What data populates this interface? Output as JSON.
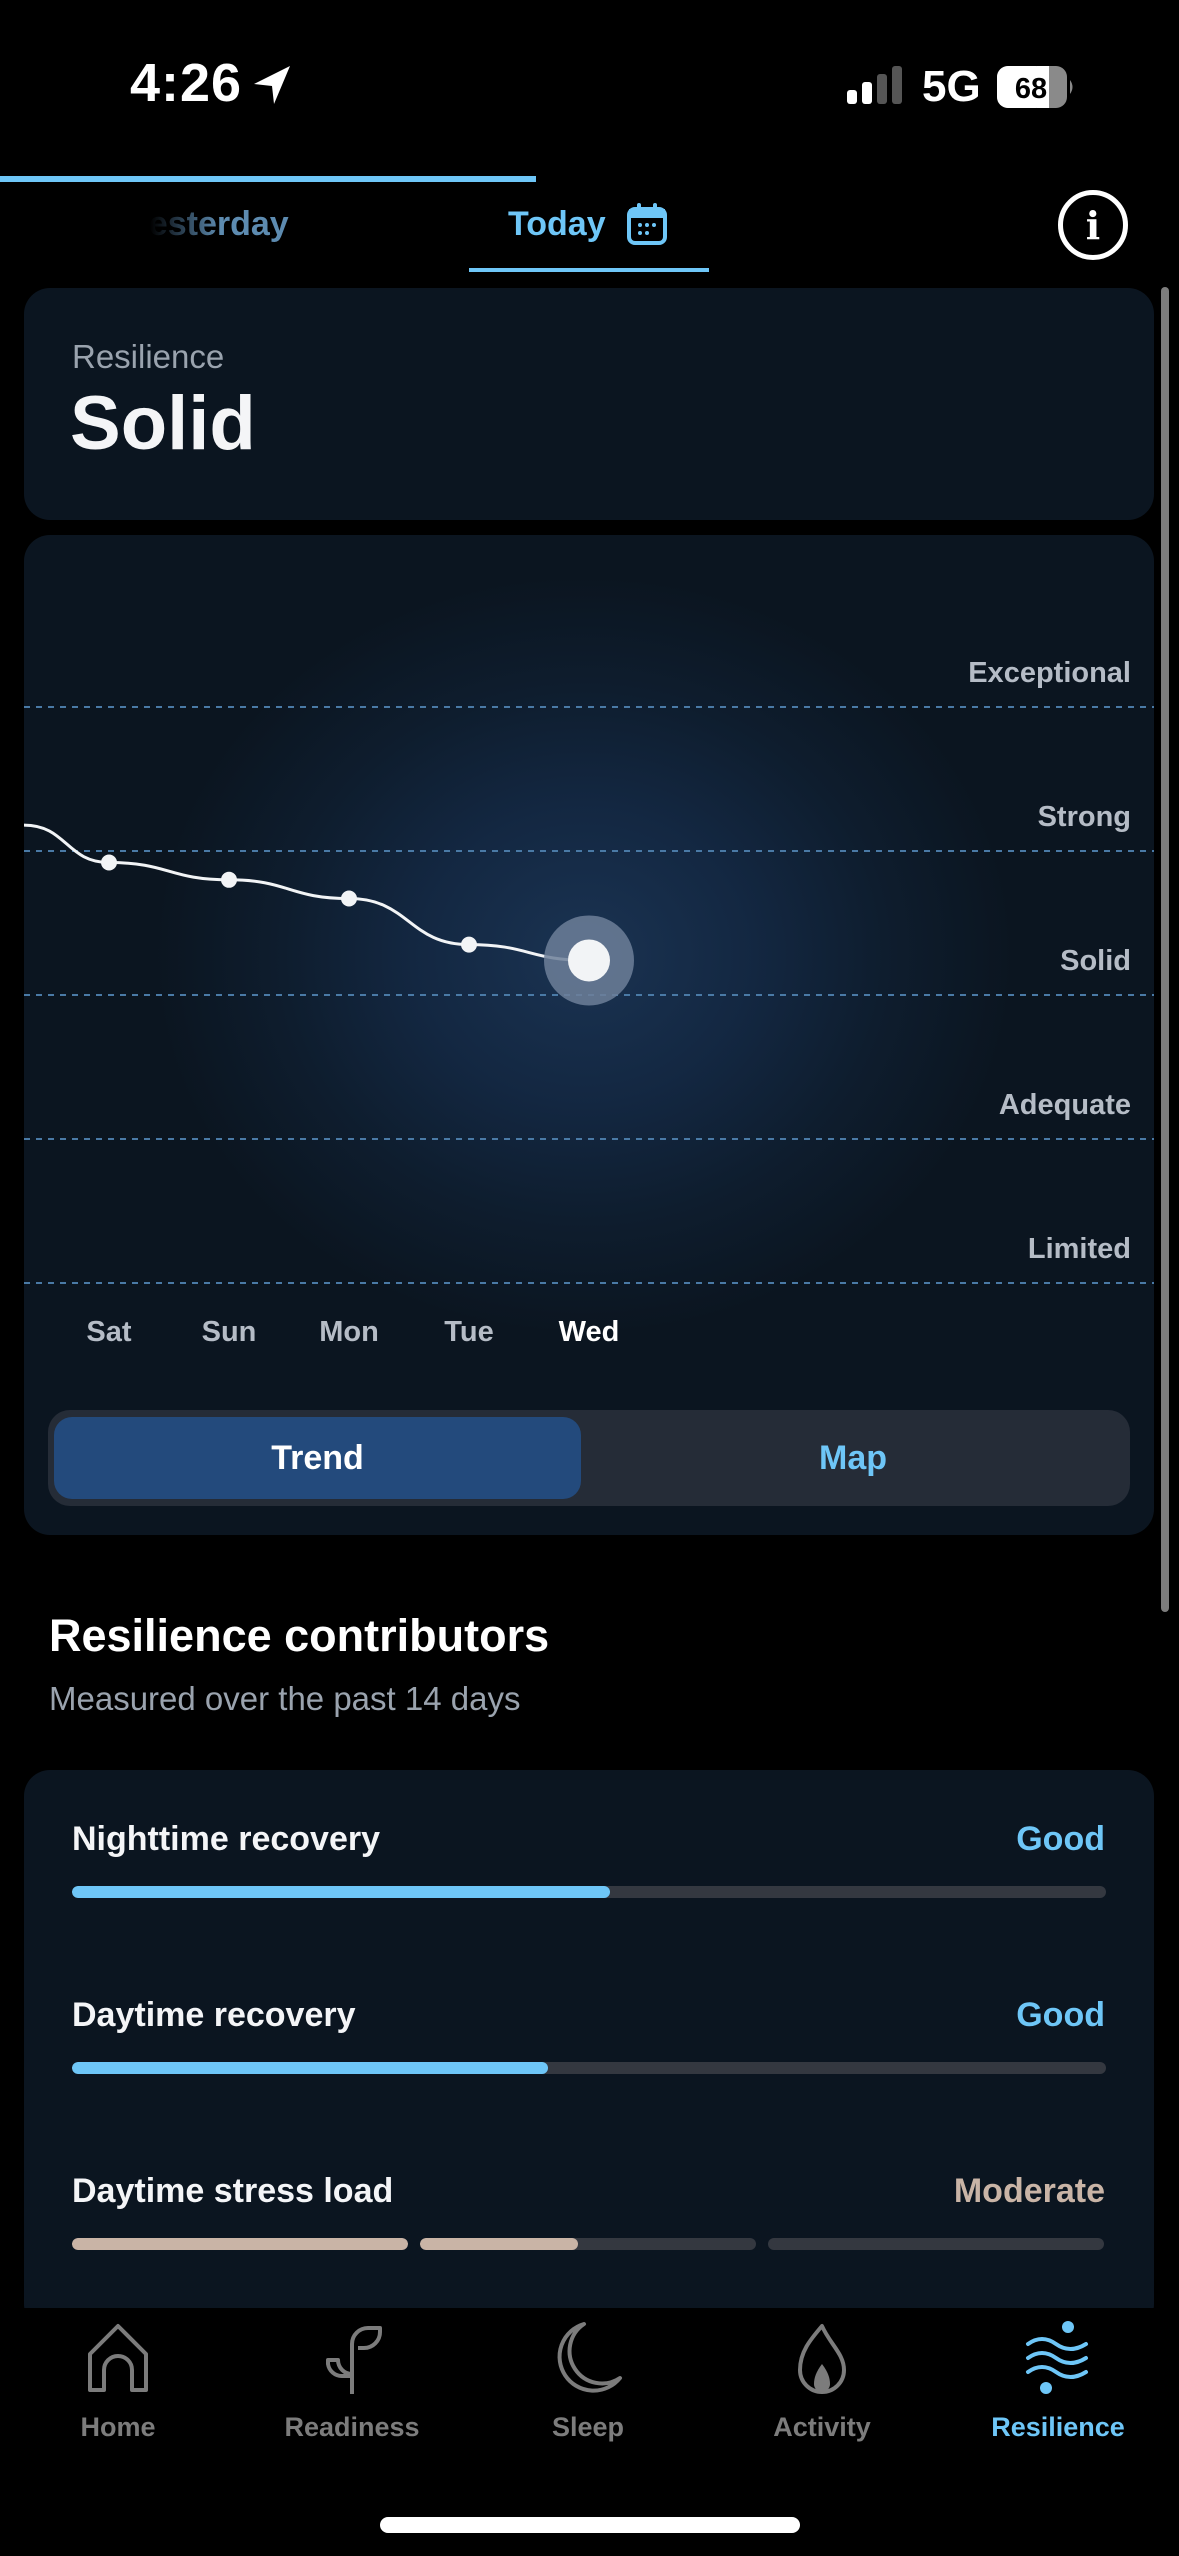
{
  "status_bar": {
    "time": "4:26",
    "network": "5G",
    "battery": "68",
    "signal_bars_active": 2,
    "signal_bars_total": 4,
    "battery_level": 0.68
  },
  "date_tabs": {
    "previous": "Yesterday",
    "previous_visible": "sterday",
    "current": "Today",
    "calendar_icon": "calendar-icon",
    "info_icon": "info-icon"
  },
  "summary": {
    "label": "Resilience",
    "value": "Solid"
  },
  "chart_data": {
    "type": "line",
    "title": "",
    "categories": [
      "Sat",
      "Sun",
      "Mon",
      "Tue",
      "Wed"
    ],
    "selected_category": "Wed",
    "levels": [
      "Limited",
      "Adequate",
      "Solid",
      "Strong",
      "Exceptional"
    ],
    "level_values": [
      1,
      2,
      3,
      4,
      5
    ],
    "series": [
      {
        "name": "Resilience",
        "values": [
          3.92,
          3.8,
          3.67,
          3.35,
          3.24
        ]
      }
    ],
    "leading_value": 4.18,
    "ylim": [
      0,
      5.5
    ],
    "grid": true,
    "xlabel": "",
    "ylabel": ""
  },
  "view_toggle": {
    "options": [
      "Trend",
      "Map"
    ],
    "selected": "Trend"
  },
  "contributors": {
    "title": "Resilience contributors",
    "subtitle": "Measured over the past 14 days",
    "items": [
      {
        "name": "Nighttime recovery",
        "status": "Good",
        "progress": 0.52,
        "type": "single"
      },
      {
        "name": "Daytime recovery",
        "status": "Good",
        "progress": 0.46,
        "type": "single"
      },
      {
        "name": "Daytime stress load",
        "status": "Moderate",
        "segments_filled": [
          1.0,
          0.47,
          0.0
        ],
        "type": "segmented"
      }
    ]
  },
  "colors": {
    "accent": "#6ec6f7",
    "moderate": "#c9b4a6",
    "card": "#0b1520",
    "toggle_selected": "#234a7c"
  },
  "nav": {
    "items": [
      {
        "label": "Home",
        "icon": "home-icon"
      },
      {
        "label": "Readiness",
        "icon": "sprout-icon"
      },
      {
        "label": "Sleep",
        "icon": "moon-icon"
      },
      {
        "label": "Activity",
        "icon": "flame-icon"
      },
      {
        "label": "Resilience",
        "icon": "waves-icon",
        "active": true
      }
    ]
  }
}
